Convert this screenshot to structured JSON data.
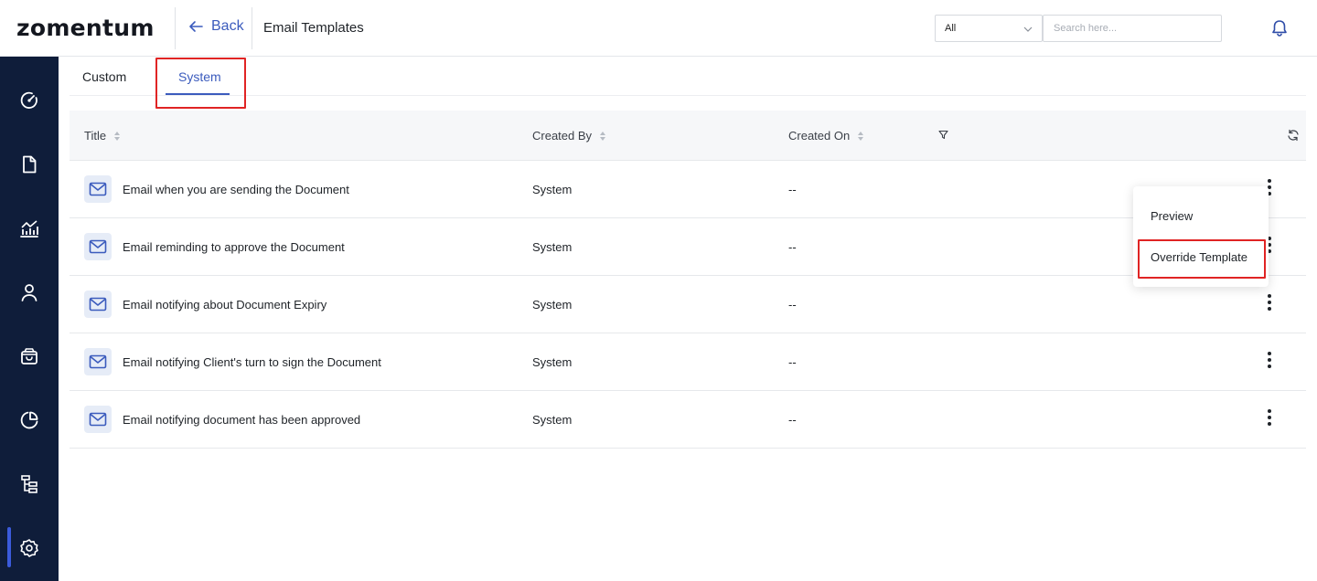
{
  "header": {
    "logo": "zomentum",
    "back_label": "Back",
    "title": "Email Templates",
    "filter_value": "All",
    "search_placeholder": "Search here..."
  },
  "sidebar": {
    "items": [
      {
        "icon": "dashboard-gauge-icon"
      },
      {
        "icon": "document-icon"
      },
      {
        "icon": "analytics-chart-icon"
      },
      {
        "icon": "user-icon"
      },
      {
        "icon": "shopping-bag-icon"
      },
      {
        "icon": "pie-chart-icon"
      },
      {
        "icon": "workflow-tree-icon"
      },
      {
        "icon": "settings-gear-icon",
        "active": true
      }
    ]
  },
  "tabs": [
    {
      "label": "Custom",
      "active": false
    },
    {
      "label": "System",
      "active": true
    }
  ],
  "table": {
    "columns": {
      "title": "Title",
      "created_by": "Created By",
      "created_on": "Created On"
    },
    "rows": [
      {
        "title": "Email when you are sending the Document",
        "created_by": "System",
        "created_on": "--"
      },
      {
        "title": "Email reminding to approve the Document",
        "created_by": "System",
        "created_on": "--"
      },
      {
        "title": "Email notifying about Document Expiry",
        "created_by": "System",
        "created_on": "--"
      },
      {
        "title": "Email notifying Client's turn to sign the Document",
        "created_by": "System",
        "created_on": "--"
      },
      {
        "title": "Email notifying document has been approved",
        "created_by": "System",
        "created_on": "--"
      }
    ]
  },
  "menu": {
    "preview": "Preview",
    "override": "Override Template"
  },
  "colors": {
    "sidebar_bg": "#0f1d3a",
    "accent": "#3b5bbd",
    "highlight": "#e02424"
  }
}
